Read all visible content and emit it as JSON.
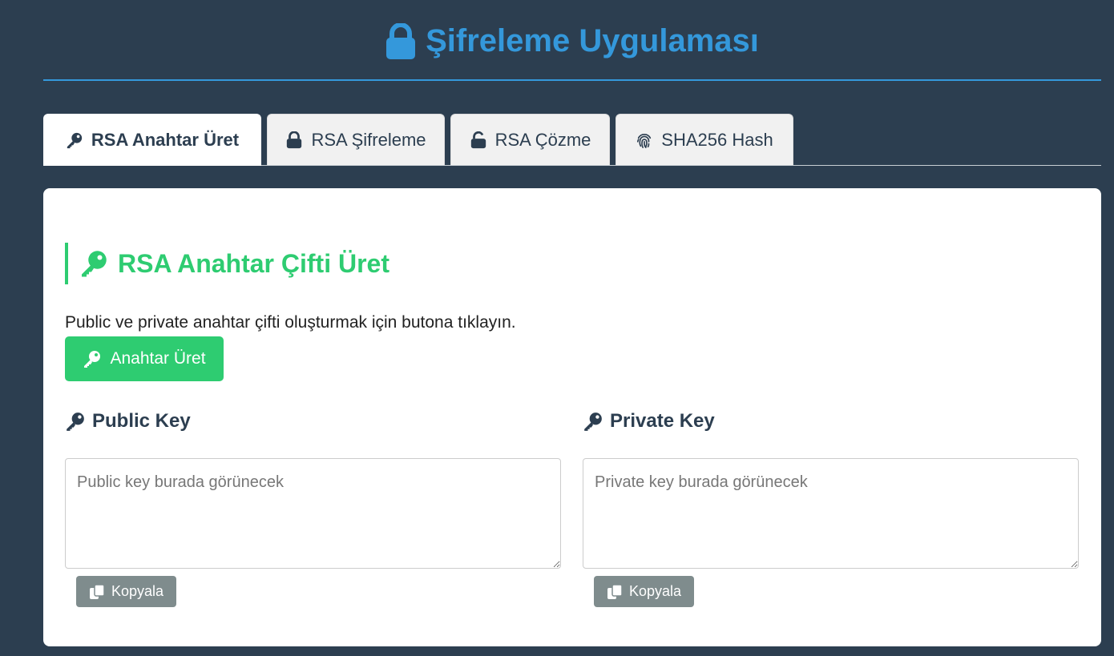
{
  "header": {
    "title": "Şifreleme Uygulaması",
    "icon": "lock-icon"
  },
  "tabs": [
    {
      "label": "RSA Anahtar Üret",
      "icon": "key-icon",
      "active": true
    },
    {
      "label": "RSA Şifreleme",
      "icon": "lock-icon",
      "active": false
    },
    {
      "label": "RSA Çözme",
      "icon": "unlock-icon",
      "active": false
    },
    {
      "label": "SHA256 Hash",
      "icon": "fingerprint-icon",
      "active": false
    }
  ],
  "section": {
    "title": "RSA Anahtar Çifti Üret",
    "icon": "key-icon",
    "description": "Public ve private anahtar çifti oluşturmak için butona tıklayın.",
    "generate_button": "Anahtar Üret"
  },
  "public_key": {
    "heading": "Public Key",
    "placeholder": "Public key burada görünecek",
    "value": "",
    "copy_label": "Kopyala"
  },
  "private_key": {
    "heading": "Private Key",
    "placeholder": "Private key burada görünecek",
    "value": "",
    "copy_label": "Kopyala"
  },
  "colors": {
    "background": "#2c3e50",
    "accent_blue": "#3498db",
    "accent_green": "#2ecc71",
    "copy_button": "#7f8c8d"
  }
}
